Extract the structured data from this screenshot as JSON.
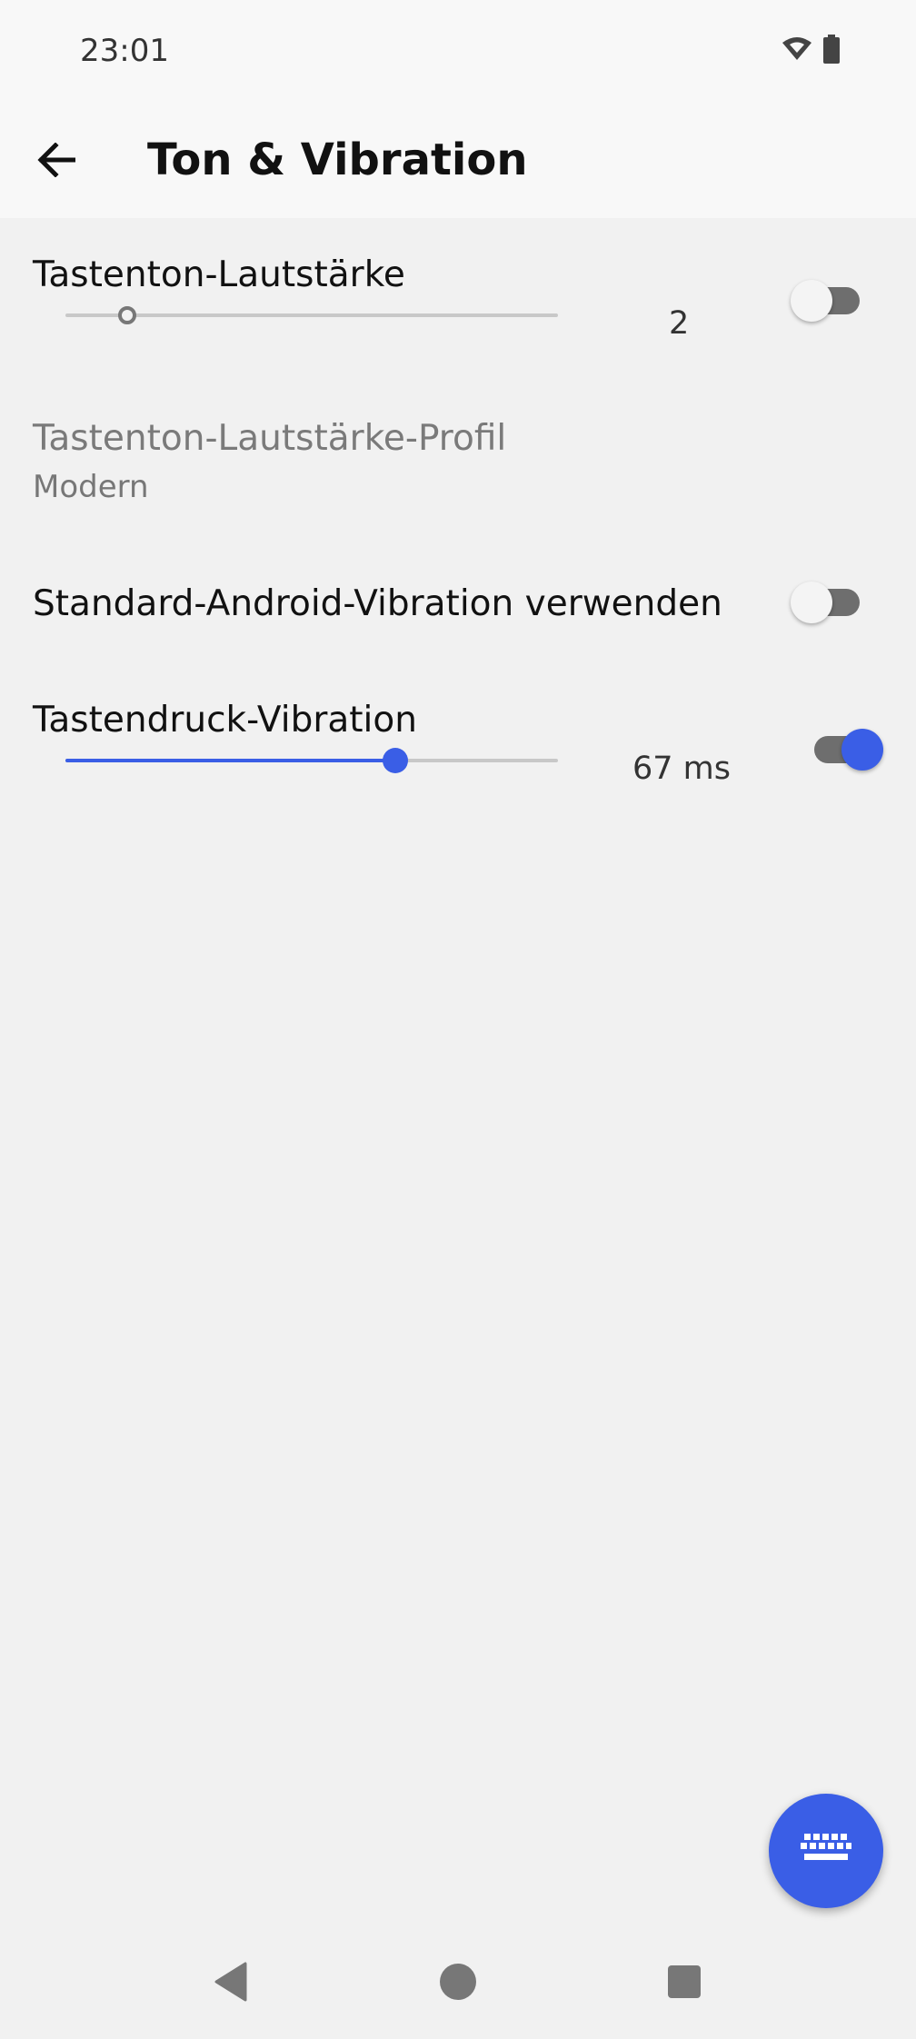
{
  "status_bar": {
    "time": "23:01",
    "icons": [
      "wifi-icon",
      "battery-icon"
    ]
  },
  "app_bar": {
    "title": "Ton & Vibration",
    "back_icon": "arrow-back-icon"
  },
  "settings": {
    "key_volume": {
      "title": "Tastenton-Lautstärke",
      "value": "2",
      "slider_fraction": 0.125,
      "switch_on": false
    },
    "sound_profile": {
      "title": "Tastenton-Lautstärke-Profil",
      "summary": "Modern",
      "enabled": false
    },
    "android_vibration": {
      "title": "Standard-Android-Vibration verwenden",
      "switch_on": false
    },
    "key_vibration": {
      "title": "Tastendruck-Vibration",
      "value": "67 ms",
      "slider_fraction": 0.67,
      "switch_on": true
    }
  },
  "fab": {
    "icon": "keyboard-icon"
  },
  "nav_bar": {
    "icons": [
      "nav-back-icon",
      "nav-home-icon",
      "nav-recents-icon"
    ]
  },
  "colors": {
    "accent": "#3a5ee6",
    "background": "#f1f1f1",
    "bar": "#f8f8f8"
  }
}
